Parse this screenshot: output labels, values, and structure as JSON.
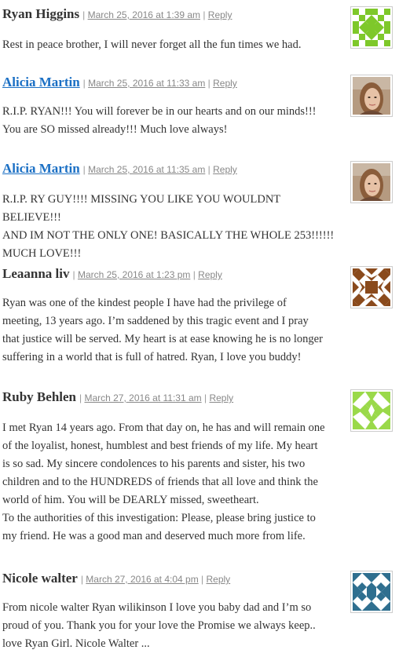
{
  "comments": [
    {
      "author": "Ryan Higgins",
      "date": "March 25, 2016 at 1:39 am",
      "reply": "Reply",
      "avatar_icon": "identicon-green-avatar",
      "body": [
        "Rest in peace brother, I will never forget all the fun times we had."
      ]
    },
    {
      "author": "Alicia Martin",
      "date": "March 25, 2016 at 11:33 am",
      "reply": "Reply",
      "avatar_icon": "user-photo-avatar",
      "body": [
        "R.I.P. RYAN!!! You will forever be in our hearts and on our minds!!!",
        "You are SO missed already!!! Much love always!"
      ]
    },
    {
      "author": "Alicia Martin",
      "date": "March 25, 2016 at 11:35 am",
      "reply": "Reply",
      "avatar_icon": "user-photo-avatar",
      "body": [
        "R.I.P. RY GUY!!!! MISSING YOU LIKE YOU WOULDNT BELIEVE!!!",
        "AND IM NOT THE ONLY ONE! BASICALLY THE WHOLE 253!!!!!!",
        "MUCH LOVE!!!"
      ]
    },
    {
      "author": "Leaanna liv",
      "date": "March 25, 2016 at 1:23 pm",
      "reply": "Reply",
      "avatar_icon": "identicon-brown-avatar",
      "body": [
        "Ryan was one of the kindest people I have had the privilege of",
        "meeting, 13 years ago. I’m saddened by this tragic event and I pray",
        "that justice will be served. My heart is at ease knowing he is no longer",
        "suffering in a world that is full of hatred. Ryan, I love you buddy!"
      ]
    },
    {
      "author": "Ruby Behlen",
      "date": "March 27, 2016 at 11:31 am",
      "reply": "Reply",
      "avatar_icon": "identicon-lime-avatar",
      "body": [
        "I met Ryan 14 years ago. From that day on, he has and will remain one",
        "of the loyalist, honest, humblest and best friends of my life. My heart",
        "is so sad. My sincere condolences to his parents and sister, his two",
        "children and to the HUNDREDS of friends that all love and think the",
        "world of him. You will be DEARLY missed, sweetheart.",
        "To the authorities of this investigation: Please, please bring justice to",
        "my friend. He was a good man and deserved much more from life."
      ]
    },
    {
      "author": "Nicole walter",
      "date": "March 27, 2016 at 4:04 pm",
      "reply": "Reply",
      "avatar_icon": "identicon-blue-avatar",
      "body": [
        "From nicole walter Ryan wilikinson I love you baby dad and I’m so",
        "proud of you. Thank you for your love the Promise we always keep..",
        "love Ryan Girl. Nicole Walter ..."
      ]
    }
  ]
}
